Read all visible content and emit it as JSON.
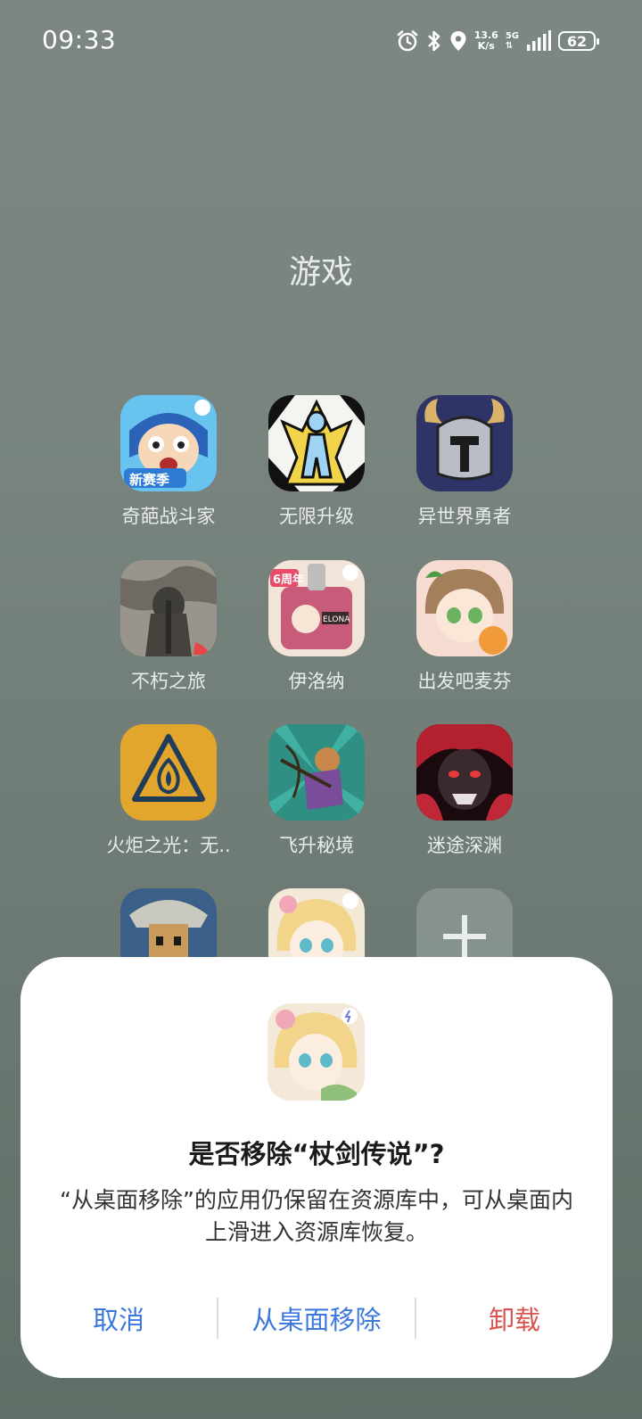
{
  "status_bar": {
    "time": "09:33",
    "net_speed_value": "13.6",
    "net_speed_unit": "K/s",
    "net_type": "5G",
    "battery": "62",
    "icons": [
      "alarm-icon",
      "bluetooth-icon",
      "location-icon",
      "signal-icon",
      "battery-icon"
    ]
  },
  "folder": {
    "title": "游戏",
    "apps": [
      {
        "label": "奇葩战斗家"
      },
      {
        "label": "无限升级"
      },
      {
        "label": "异世界勇者"
      },
      {
        "label": "不朽之旅"
      },
      {
        "label": "伊洛纳"
      },
      {
        "label": "出发吧麦芬"
      },
      {
        "label": "火炬之光：无.."
      },
      {
        "label": "飞升秘境"
      },
      {
        "label": "迷途深渊"
      }
    ],
    "add_button": "add-app-icon"
  },
  "dialog": {
    "title": "是否移除“杖剑传说”?",
    "message": "“从桌面移除”的应用仍保留在资源库中，可从桌面内上滑进入资源库恢复。",
    "cancel_label": "取消",
    "remove_label": "从桌面移除",
    "uninstall_label": "卸载",
    "colors": {
      "primary": "#3b78dd",
      "danger": "#d9534f"
    }
  }
}
